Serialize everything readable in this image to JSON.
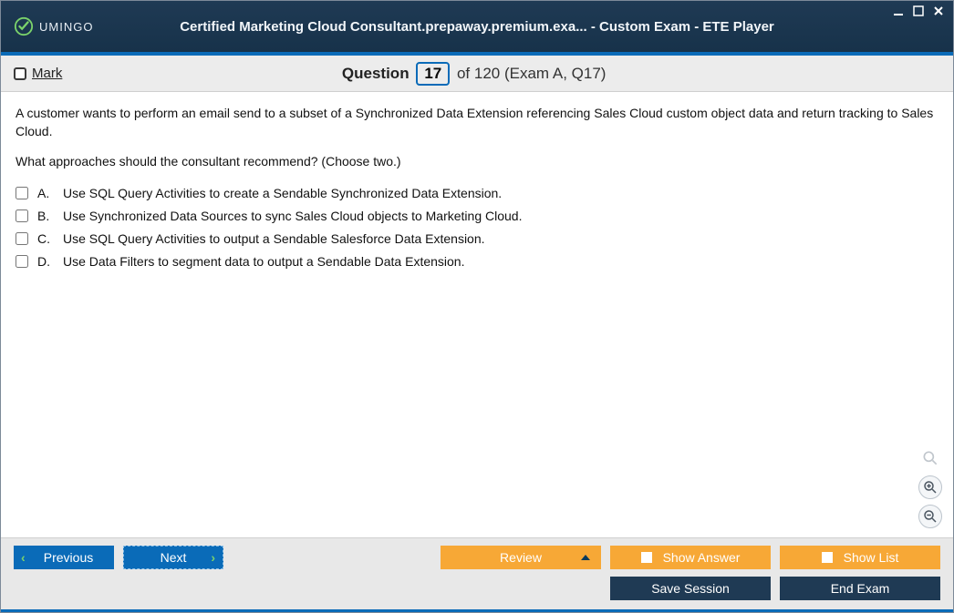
{
  "window": {
    "logo_text": "UMINGO",
    "title": "Certified Marketing Cloud Consultant.prepaway.premium.exa... - Custom Exam - ETE Player"
  },
  "questionbar": {
    "mark_label": "Mark",
    "question_word": "Question",
    "current": "17",
    "suffix": "of 120 (Exam A, Q17)"
  },
  "content": {
    "stem1": "A customer wants to perform an email send to a subset of a Synchronized Data Extension referencing Sales Cloud custom object data and return tracking to Sales Cloud.",
    "stem2": "What approaches should the consultant recommend? (Choose two.)",
    "options": [
      {
        "letter": "A.",
        "text": "Use SQL Query Activities to create a Sendable Synchronized Data Extension."
      },
      {
        "letter": "B.",
        "text": "Use Synchronized Data Sources to sync Sales Cloud objects to Marketing Cloud."
      },
      {
        "letter": "C.",
        "text": "Use SQL Query Activities to output a Sendable Salesforce Data Extension."
      },
      {
        "letter": "D.",
        "text": "Use Data Filters to segment data to output a Sendable Data Extension."
      }
    ]
  },
  "footer": {
    "previous": "Previous",
    "next": "Next",
    "review": "Review",
    "show_answer": "Show Answer",
    "show_list": "Show List",
    "save_session": "Save Session",
    "end_exam": "End Exam"
  }
}
